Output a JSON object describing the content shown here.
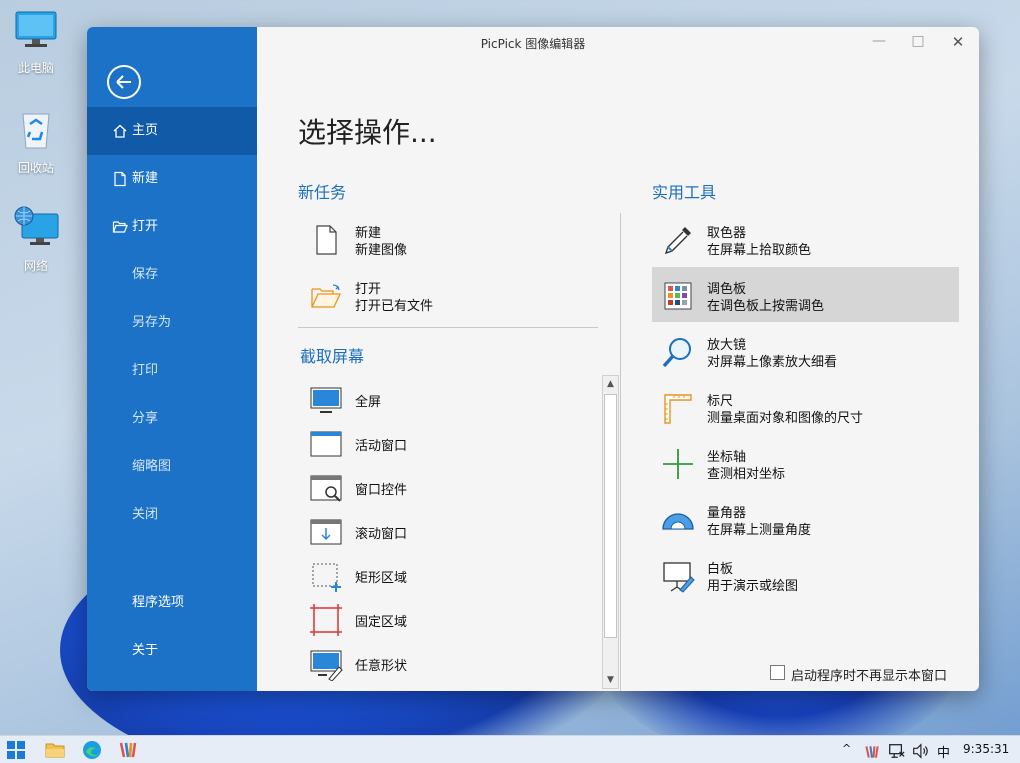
{
  "desktop": {
    "icons": [
      {
        "label": "此电脑"
      },
      {
        "label": "回收站"
      },
      {
        "label": "网络"
      }
    ]
  },
  "window": {
    "title": "PicPick 图像编辑器",
    "controls": {
      "minimize": "—",
      "maximize": "□",
      "close": "✕"
    }
  },
  "sidebar": {
    "items": [
      {
        "label": "主页"
      },
      {
        "label": "新建"
      },
      {
        "label": "打开"
      },
      {
        "label": "保存"
      },
      {
        "label": "另存为"
      },
      {
        "label": "打印"
      },
      {
        "label": "分享"
      },
      {
        "label": "缩略图"
      },
      {
        "label": "关闭"
      },
      {
        "label": "程序选项"
      },
      {
        "label": "关于"
      }
    ]
  },
  "main": {
    "heading": "选择操作...",
    "new_task": {
      "title": "新任务",
      "items": [
        {
          "title": "新建",
          "desc": "新建图像"
        },
        {
          "title": "打开",
          "desc": "打开已有文件"
        }
      ]
    },
    "capture": {
      "title": "截取屏幕",
      "items": [
        {
          "label": "全屏"
        },
        {
          "label": "活动窗口"
        },
        {
          "label": "窗口控件"
        },
        {
          "label": "滚动窗口"
        },
        {
          "label": "矩形区域"
        },
        {
          "label": "固定区域"
        },
        {
          "label": "任意形状"
        }
      ]
    },
    "tools": {
      "title": "实用工具",
      "items": [
        {
          "title": "取色器",
          "desc": "在屏幕上拾取颜色"
        },
        {
          "title": "调色板",
          "desc": "在调色板上按需调色"
        },
        {
          "title": "放大镜",
          "desc": "对屏幕上像素放大细看"
        },
        {
          "title": "标尺",
          "desc": "测量桌面对象和图像的尺寸"
        },
        {
          "title": "坐标轴",
          "desc": "查测相对坐标"
        },
        {
          "title": "量角器",
          "desc": "在屏幕上测量角度"
        },
        {
          "title": "白板",
          "desc": "用于演示或绘图"
        }
      ]
    },
    "startup_checkbox": {
      "label": "启动程序时不再显示本窗口",
      "checked": false
    }
  },
  "taskbar": {
    "ime": "中",
    "time": "9:35:31"
  },
  "colors": {
    "sidebar": "#1c72c6",
    "sidebar_active": "#115aa8",
    "accent": "#1c6fc0",
    "highlight": "#d6d6d6"
  }
}
